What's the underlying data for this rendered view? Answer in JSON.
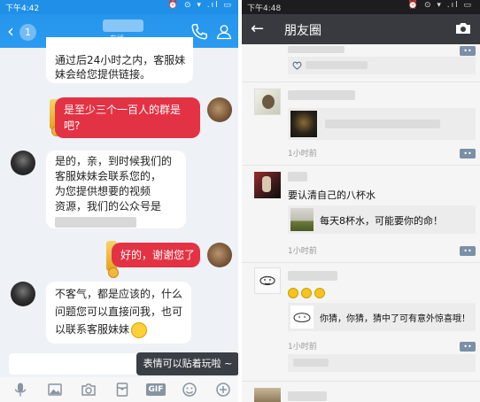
{
  "qq": {
    "status_time": "下午4:42",
    "status_icons": "⏰ ⊙ ▾ .ıl ▭",
    "back_badge": "1",
    "contact_status": "在线",
    "messages": {
      "m1_line1": "通过后24小时之内，客服妹",
      "m1_line2": "妹会给您提供链接。",
      "m2_line1": "是至少三个一百人的群是",
      "m2_line2": "吧?",
      "m3_line1": "是的，亲，到时候我们的",
      "m3_line2": "客服妹妹会联系您的，",
      "m3_line3": "为您提供想要的视频",
      "m3_line4": "资源，我们的公众号是",
      "m4": "好的，谢谢您了",
      "m5_line1": "不客气，都是应该的，什么",
      "m5_line2": "问题您可以直接问我，也可",
      "m5_line3": "以联系客服妹妹"
    },
    "tooltip": "表情可以贴着玩啦 ~",
    "toolbar": {
      "gif": "GIF"
    }
  },
  "wechat": {
    "status_time": "下午4:48",
    "status_icons": "⏰ ⊙ ▾ .ıl ▭",
    "back_icon": "←",
    "title": "朋友圈",
    "posts": {
      "p2_time": "1小时前",
      "p3_text": "要认清自己的八杯水",
      "p3_share": "每天8杯水，可能要你的命！",
      "p3_time": "1小时前",
      "p4_share": "你猜，你猜，猜中了可有意外惊喜哦！",
      "p4_time": "1小时前"
    }
  }
}
